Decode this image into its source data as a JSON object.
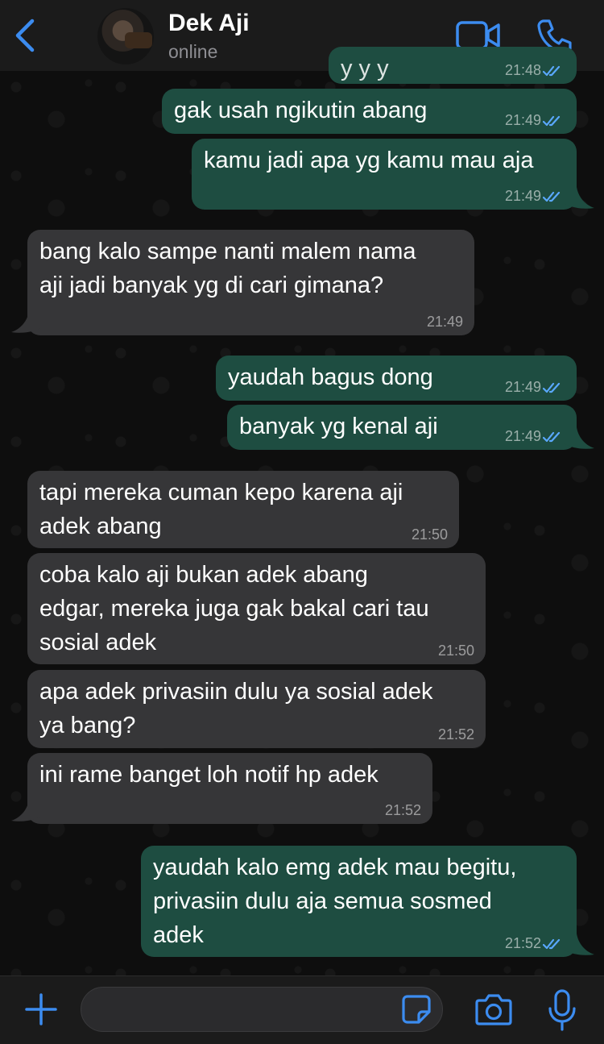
{
  "header": {
    "contact_name": "Dek Aji",
    "status": "online"
  },
  "messages": [
    {
      "direction": "out",
      "text": "y   y   y",
      "time": "21:48",
      "ticks": "read"
    },
    {
      "direction": "out",
      "text": "gak usah ngikutin abang",
      "time": "21:49",
      "ticks": "read"
    },
    {
      "direction": "out",
      "text": "kamu jadi apa yg kamu mau aja",
      "time": "21:49",
      "ticks": "read"
    },
    {
      "direction": "in",
      "text": "bang kalo sampe nanti malem nama\naji jadi banyak yg di cari gimana?",
      "time": "21:49"
    },
    {
      "direction": "out",
      "text": "yaudah bagus dong",
      "time": "21:49",
      "ticks": "read"
    },
    {
      "direction": "out",
      "text": "banyak yg kenal aji",
      "time": "21:49",
      "ticks": "read"
    },
    {
      "direction": "in",
      "text": "tapi mereka cuman kepo karena aji\nadek abang",
      "time": "21:50"
    },
    {
      "direction": "in",
      "text": "coba kalo aji bukan adek abang\nedgar, mereka juga gak bakal cari tau\nsosial adek",
      "time": "21:50"
    },
    {
      "direction": "in",
      "text": "apa adek privasiin dulu ya sosial adek\nya bang?",
      "time": "21:52"
    },
    {
      "direction": "in",
      "text": "ini rame banget loh notif hp adek",
      "time": "21:52"
    },
    {
      "direction": "out",
      "text": "yaudah kalo emg adek mau begitu,\nprivasiin dulu aja semua sosmed\nadek",
      "time": "21:52",
      "ticks": "read"
    }
  ],
  "composer": {
    "placeholder": ""
  },
  "icons": {
    "back": "chevron-left-icon",
    "video": "video-camera-icon",
    "call": "phone-icon",
    "plus": "plus-icon",
    "sticker": "sticker-icon",
    "camera": "camera-icon",
    "mic": "microphone-icon"
  },
  "colors": {
    "accent": "#3c8cf0",
    "outgoing_bubble": "#1e4d41",
    "incoming_bubble": "#363638",
    "read_ticks": "#5aa8ff"
  }
}
